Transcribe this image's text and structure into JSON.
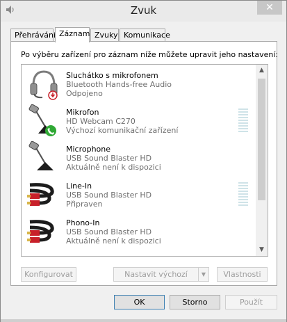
{
  "window": {
    "title": "Zvuk",
    "close_glyph": "✕"
  },
  "tabs": [
    {
      "label": "Přehrávání"
    },
    {
      "label": "Záznam"
    },
    {
      "label": "Zvuky"
    },
    {
      "label": "Komunikace"
    }
  ],
  "instruction": "Po výběru zařízení pro záznam níže můžete upravit jeho nastavení:",
  "devices": [
    {
      "name": "Sluchátko s mikrofonem",
      "driver": "Bluetooth Hands-free Audio",
      "status": "Odpojeno",
      "icon": "headset-icon",
      "badge": "disconnected-badge"
    },
    {
      "name": "Mikrofon",
      "driver": "HD Webcam C270",
      "status": "Výchozí komunikační zařízení",
      "icon": "microphone-icon",
      "badge": "default-communication-badge"
    },
    {
      "name": "Microphone",
      "driver": "USB Sound Blaster HD",
      "status": "Aktuálně není k dispozici",
      "icon": "microphone-icon"
    },
    {
      "name": "Line-In",
      "driver": "USB Sound Blaster HD",
      "status": "Připraven",
      "icon": "rca-cable-icon"
    },
    {
      "name": "Phono-In",
      "driver": "USB Sound Blaster HD",
      "status": "Aktuálně není k dispozici",
      "icon": "rca-cable-icon"
    }
  ],
  "buttons": {
    "configure": "Konfigurovat",
    "set_default": "Nastavit výchozí",
    "properties": "Vlastnosti",
    "ok": "OK",
    "cancel": "Storno",
    "apply": "Použít"
  },
  "colors": {
    "accent": "#3c7fb1",
    "meter": "#cfe3e8",
    "green_badge": "#2fa834",
    "red_badge": "#c8202a"
  }
}
